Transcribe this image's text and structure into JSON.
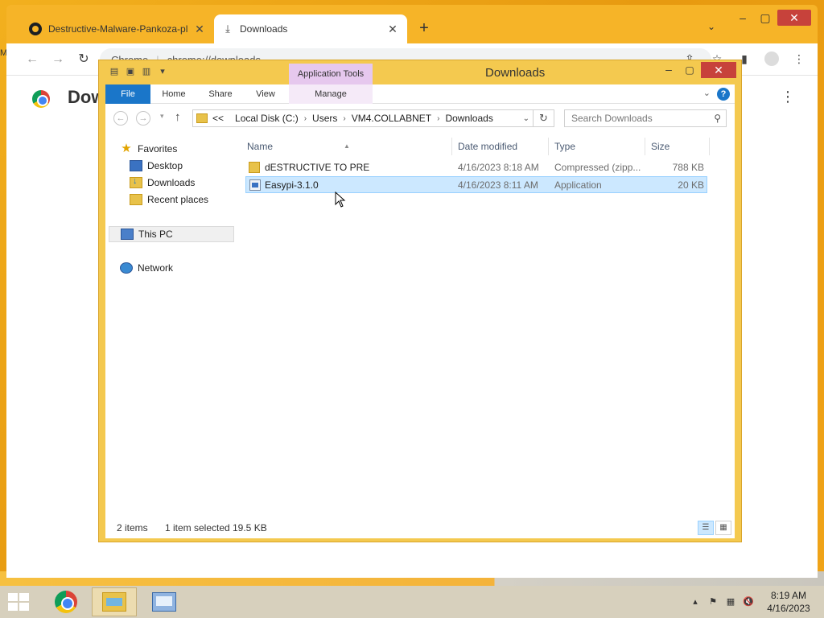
{
  "chrome": {
    "tabs": [
      {
        "label": "Destructive-Malware-Pankoza-pl",
        "active": false
      },
      {
        "label": "Downloads",
        "active": true
      }
    ],
    "new_tab_label": "+",
    "omnibox": {
      "site_label": "Chrome",
      "url": "chrome://downloads"
    },
    "page": {
      "title": "Downloads"
    }
  },
  "explorer": {
    "title": "Downloads",
    "contextual_tab_group": "Application Tools",
    "ribbon_tabs": [
      "File",
      "Home",
      "Share",
      "View",
      "Manage"
    ],
    "breadcrumb": {
      "overflow": "<<",
      "segments": [
        "Local Disk (C:)",
        "Users",
        "VM4.COLLABNET",
        "Downloads"
      ]
    },
    "search_placeholder": "Search Downloads",
    "nav_pane": {
      "favorites_label": "Favorites",
      "favorites": [
        "Desktop",
        "Downloads",
        "Recent places"
      ],
      "this_pc": "This PC",
      "network": "Network"
    },
    "columns": [
      "Name",
      "Date modified",
      "Type",
      "Size"
    ],
    "files": [
      {
        "name": "dESTRUCTIVE TO PRE",
        "date": "4/16/2023 8:18 AM",
        "type": "Compressed (zipp...",
        "size": "788 KB",
        "icon": "zip-folder-icon",
        "selected": false
      },
      {
        "name": "Easypi-3.1.0",
        "date": "4/16/2023 8:11 AM",
        "type": "Application",
        "size": "20 KB",
        "icon": "application-icon",
        "selected": true
      }
    ],
    "status": {
      "items": "2 items",
      "selection": "1 item selected",
      "selection_size": "19.5 KB"
    }
  },
  "taskbar": {
    "time": "8:19 AM",
    "date": "4/16/2023"
  },
  "colors": {
    "desktop": "#e8a317",
    "explorer_frame": "#f4c94f",
    "file_tab": "#1a76c9",
    "selection": "#cce8ff",
    "close_button": "#c7423b",
    "taskbar": "#d7d0bd"
  }
}
